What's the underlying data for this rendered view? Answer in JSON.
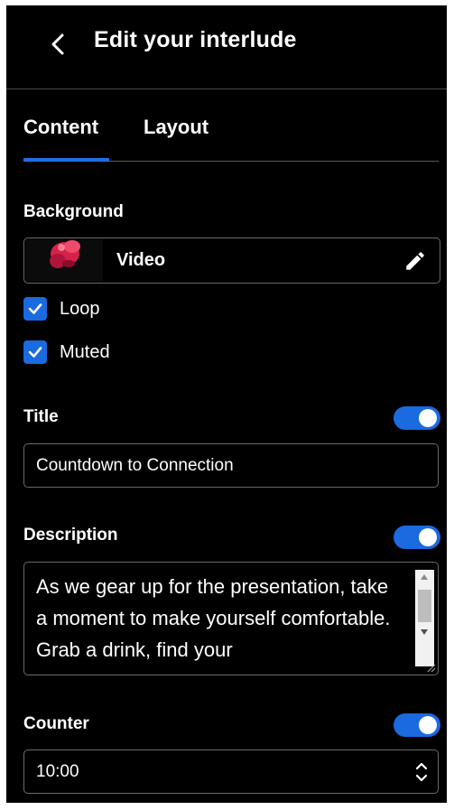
{
  "header": {
    "title": "Edit your interlude"
  },
  "tabs": [
    {
      "label": "Content",
      "active": true
    },
    {
      "label": "Layout",
      "active": false
    }
  ],
  "background": {
    "label": "Background",
    "type_label": "Video",
    "options": [
      {
        "label": "Loop",
        "checked": true
      },
      {
        "label": "Muted",
        "checked": true
      }
    ]
  },
  "title_field": {
    "label": "Title",
    "enabled": true,
    "value": "Countdown to Connection"
  },
  "description_field": {
    "label": "Description",
    "enabled": true,
    "value": "As we gear up for the presentation, take a moment to make yourself comfortable. Grab a drink, find your"
  },
  "counter_field": {
    "label": "Counter",
    "enabled": true,
    "value": "10:00"
  },
  "colors": {
    "panel_bg": "#000000",
    "accent": "#1a6ae0",
    "border": "#6a6a6a",
    "text": "#ffffff"
  },
  "icons": [
    "chevron-left-icon",
    "pencil-icon",
    "checkmark-icon",
    "spinner-arrows-icon"
  ]
}
